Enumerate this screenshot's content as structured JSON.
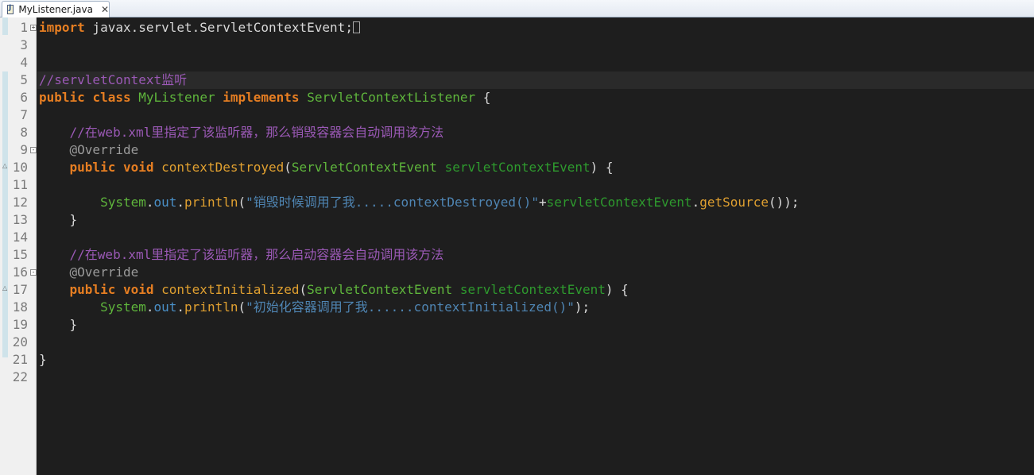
{
  "tab": {
    "icon": "java-file-icon",
    "label": "MyListener.java",
    "close": "✕"
  },
  "lines": [
    {
      "n": "1",
      "tokens": [
        [
          "kw",
          "import"
        ],
        [
          "plain",
          " javax.servlet.ServletContextEvent;"
        ]
      ],
      "fold": "+",
      "box": true
    },
    {
      "n": "3",
      "tokens": []
    },
    {
      "n": "4",
      "tokens": []
    },
    {
      "n": "5",
      "tokens": [
        [
          "comment",
          "//servletContext监听"
        ]
      ]
    },
    {
      "n": "6",
      "tokens": [
        [
          "kw",
          "public"
        ],
        [
          "plain",
          " "
        ],
        [
          "kw",
          "class"
        ],
        [
          "plain",
          " "
        ],
        [
          "cls",
          "MyListener"
        ],
        [
          "plain",
          " "
        ],
        [
          "kw",
          "implements"
        ],
        [
          "plain",
          " "
        ],
        [
          "cls",
          "ServletContextListener"
        ],
        [
          "plain",
          " {"
        ]
      ]
    },
    {
      "n": "7",
      "tokens": []
    },
    {
      "n": "8",
      "tokens": [
        [
          "plain",
          "    "
        ],
        [
          "comment",
          "//在web.xml里指定了该监听器，那么销毁容器会自动调用该方法"
        ]
      ]
    },
    {
      "n": "9",
      "tokens": [
        [
          "plain",
          "    "
        ],
        [
          "annot",
          "@Override"
        ]
      ],
      "fold": "-"
    },
    {
      "n": "10",
      "tokens": [
        [
          "plain",
          "    "
        ],
        [
          "kw",
          "public"
        ],
        [
          "plain",
          " "
        ],
        [
          "kw",
          "void"
        ],
        [
          "plain",
          " "
        ],
        [
          "method",
          "contextDestroyed"
        ],
        [
          "plain",
          "("
        ],
        [
          "cls",
          "ServletContextEvent"
        ],
        [
          "plain",
          " "
        ],
        [
          "param",
          "servletContextEvent"
        ],
        [
          "plain",
          ") {"
        ]
      ]
    },
    {
      "n": "11",
      "tokens": []
    },
    {
      "n": "12",
      "tokens": [
        [
          "plain",
          "        "
        ],
        [
          "sysobj",
          "System"
        ],
        [
          "plain",
          "."
        ],
        [
          "field",
          "out"
        ],
        [
          "plain",
          "."
        ],
        [
          "method",
          "println"
        ],
        [
          "plain",
          "("
        ],
        [
          "string",
          "\"销毁时候调用了我.....contextDestroyed()\""
        ],
        [
          "plain",
          "+"
        ],
        [
          "param",
          "servletContextEvent"
        ],
        [
          "plain",
          "."
        ],
        [
          "method",
          "getSource"
        ],
        [
          "plain",
          "());"
        ]
      ]
    },
    {
      "n": "13",
      "tokens": [
        [
          "plain",
          "    }"
        ]
      ]
    },
    {
      "n": "14",
      "tokens": []
    },
    {
      "n": "15",
      "tokens": [
        [
          "plain",
          "    "
        ],
        [
          "comment",
          "//在web.xml里指定了该监听器，那么启动容器会自动调用该方法"
        ]
      ]
    },
    {
      "n": "16",
      "tokens": [
        [
          "plain",
          "    "
        ],
        [
          "annot",
          "@Override"
        ]
      ],
      "fold": "-"
    },
    {
      "n": "17",
      "tokens": [
        [
          "plain",
          "    "
        ],
        [
          "kw",
          "public"
        ],
        [
          "plain",
          " "
        ],
        [
          "kw",
          "void"
        ],
        [
          "plain",
          " "
        ],
        [
          "method",
          "contextInitialized"
        ],
        [
          "plain",
          "("
        ],
        [
          "cls",
          "ServletContextEvent"
        ],
        [
          "plain",
          " "
        ],
        [
          "param",
          "servletContextEvent"
        ],
        [
          "plain",
          ") {"
        ]
      ]
    },
    {
      "n": "18",
      "tokens": [
        [
          "plain",
          "        "
        ],
        [
          "sysobj",
          "System"
        ],
        [
          "plain",
          "."
        ],
        [
          "field",
          "out"
        ],
        [
          "plain",
          "."
        ],
        [
          "method",
          "println"
        ],
        [
          "plain",
          "("
        ],
        [
          "string",
          "\"初始化容器调用了我......contextInitialized()\""
        ],
        [
          "plain",
          ");"
        ]
      ]
    },
    {
      "n": "19",
      "tokens": [
        [
          "plain",
          "    }"
        ]
      ]
    },
    {
      "n": "20",
      "tokens": []
    },
    {
      "n": "21",
      "tokens": [
        [
          "plain",
          "}"
        ]
      ]
    },
    {
      "n": "22",
      "tokens": []
    }
  ]
}
